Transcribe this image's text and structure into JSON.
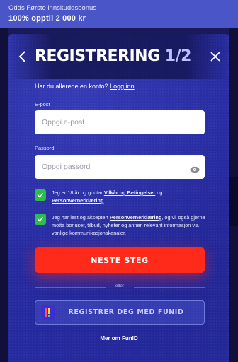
{
  "promo": {
    "line1": "Odds Første innskuddsbonus",
    "line2": "100% opptil 2 000 kr"
  },
  "header": {
    "title": "REGISTRERING ",
    "step": "1/2",
    "back_icon": "chevron-left-icon",
    "close_icon": "close-icon"
  },
  "login": {
    "prompt": "Har du allerede en konto?",
    "link": "Logg inn"
  },
  "form": {
    "email_label": "E-post",
    "email_placeholder": "Oppgi e-post",
    "password_label": "Passord",
    "password_placeholder": "Oppgi passord",
    "eye_icon": "eye-icon"
  },
  "consents": [
    {
      "checked": true,
      "text_before": "Jeg er 18 år og godtar ",
      "link1": "Vilkår og Betingelser",
      "text_mid": " og ",
      "link2": "Personvernerklæring",
      "text_after": ""
    },
    {
      "checked": true,
      "text_before": "Jeg har lest og akseptert ",
      "link1": "Personvernerklæring",
      "text_after": ", og vil også gjerne motta bonuser, tilbud, nyheter og annen relevant informasjon via vanlige kommunikasjonskanaler."
    }
  ],
  "cta_label": "NESTE STEG",
  "divider_text": "eller",
  "funid": {
    "label": "REGISTRER DEG MED FUNID",
    "logo_icon": "funid-logo-icon"
  },
  "more_link": "Mer om FunID",
  "colors": {
    "promo_bg": "#4a55c8",
    "modal_bg": "#262aa0",
    "cta": "#ff2a1a",
    "check": "#2dbd4e"
  }
}
